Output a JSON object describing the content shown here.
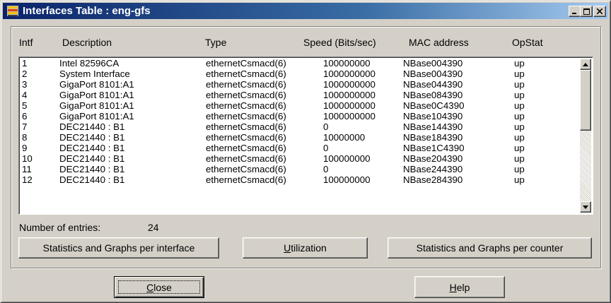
{
  "window": {
    "title": "Interfaces Table : eng-gfs",
    "controls": {
      "minimize": "minimize-icon",
      "maximize": "maximize-icon",
      "close": "close-icon"
    }
  },
  "table": {
    "columns": [
      "Intf",
      "Description",
      "Type",
      "Speed (Bits/sec)",
      "MAC address",
      "OpStat"
    ],
    "rows": [
      [
        "1",
        "Intel 82596CA",
        "ethernetCsmacd(6)",
        "100000000",
        "NBase004390",
        "up"
      ],
      [
        "2",
        "System Interface",
        "ethernetCsmacd(6)",
        "1000000000",
        "NBase004390",
        "up"
      ],
      [
        "3",
        "GigaPort 8101:A1",
        "ethernetCsmacd(6)",
        "1000000000",
        "NBase044390",
        "up"
      ],
      [
        "4",
        "GigaPort 8101:A1",
        "ethernetCsmacd(6)",
        "1000000000",
        "NBase084390",
        "up"
      ],
      [
        "5",
        "GigaPort 8101:A1",
        "ethernetCsmacd(6)",
        "1000000000",
        "NBase0C4390",
        "up"
      ],
      [
        "6",
        "GigaPort 8101:A1",
        "ethernetCsmacd(6)",
        "1000000000",
        "NBase104390",
        "up"
      ],
      [
        "7",
        "DEC21440 : B1",
        "ethernetCsmacd(6)",
        "0",
        "NBase144390",
        "up"
      ],
      [
        "8",
        "DEC21440 : B1",
        "ethernetCsmacd(6)",
        "10000000",
        "NBase184390",
        "up"
      ],
      [
        "9",
        "DEC21440 : B1",
        "ethernetCsmacd(6)",
        "0",
        "NBase1C4390",
        "up"
      ],
      [
        "10",
        "DEC21440 : B1",
        "ethernetCsmacd(6)",
        "100000000",
        "NBase204390",
        "up"
      ],
      [
        "11",
        "DEC21440 : B1",
        "ethernetCsmacd(6)",
        "0",
        "NBase244390",
        "up"
      ],
      [
        "12",
        "DEC21440 : B1",
        "ethernetCsmacd(6)",
        "100000000",
        "NBase284390",
        "up"
      ]
    ]
  },
  "entries": {
    "label": "Number of entries:",
    "count": "24"
  },
  "buttons": {
    "stats_interface": "Statistics and Graphs per interface",
    "utilization_prefix": "",
    "utilization_key": "U",
    "utilization_rest": "tilization",
    "stats_counter": "Statistics and Graphs per counter",
    "close_key": "C",
    "close_rest": "lose",
    "help_key": "H",
    "help_rest": "elp"
  },
  "colors": {
    "titlebar_start": "#0a246a",
    "titlebar_end": "#a6caf0",
    "face": "#d4d0c8"
  }
}
